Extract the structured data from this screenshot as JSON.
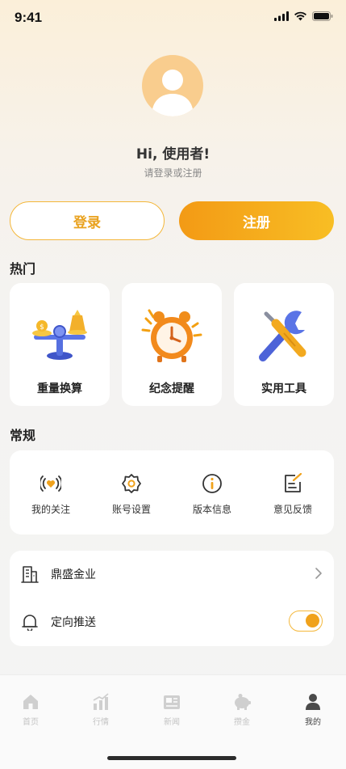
{
  "status_bar": {
    "time": "9:41"
  },
  "profile": {
    "greeting": "Hi, 使用者!",
    "subtitle": "请登录或注册"
  },
  "auth": {
    "login_label": "登录",
    "register_label": "注册"
  },
  "hot": {
    "title": "热门",
    "items": [
      {
        "label": "重量换算",
        "icon": "scale-icon"
      },
      {
        "label": "纪念提醒",
        "icon": "alarm-clock-icon"
      },
      {
        "label": "实用工具",
        "icon": "tools-icon"
      }
    ]
  },
  "general": {
    "title": "常规",
    "items": [
      {
        "label": "我的关注",
        "icon": "heart-signal-icon"
      },
      {
        "label": "账号设置",
        "icon": "gear-icon"
      },
      {
        "label": "版本信息",
        "icon": "info-icon"
      },
      {
        "label": "意见反馈",
        "icon": "feedback-edit-icon"
      }
    ]
  },
  "list": {
    "company": {
      "label": "鼎盛金业",
      "icon": "building-icon"
    },
    "push": {
      "label": "定向推送",
      "icon": "bell-icon",
      "enabled": true
    }
  },
  "tabs": [
    {
      "label": "首页",
      "icon": "home-icon",
      "active": false
    },
    {
      "label": "行情",
      "icon": "chart-icon",
      "active": false
    },
    {
      "label": "新闻",
      "icon": "news-icon",
      "active": false
    },
    {
      "label": "攒金",
      "icon": "piggy-bank-icon",
      "active": false
    },
    {
      "label": "我的",
      "icon": "person-icon",
      "active": true
    }
  ],
  "colors": {
    "accent": "#f4a51c",
    "accent_light": "#f8be24",
    "background": "#f4f4f4",
    "avatar_bg": "#f9cd8e"
  }
}
